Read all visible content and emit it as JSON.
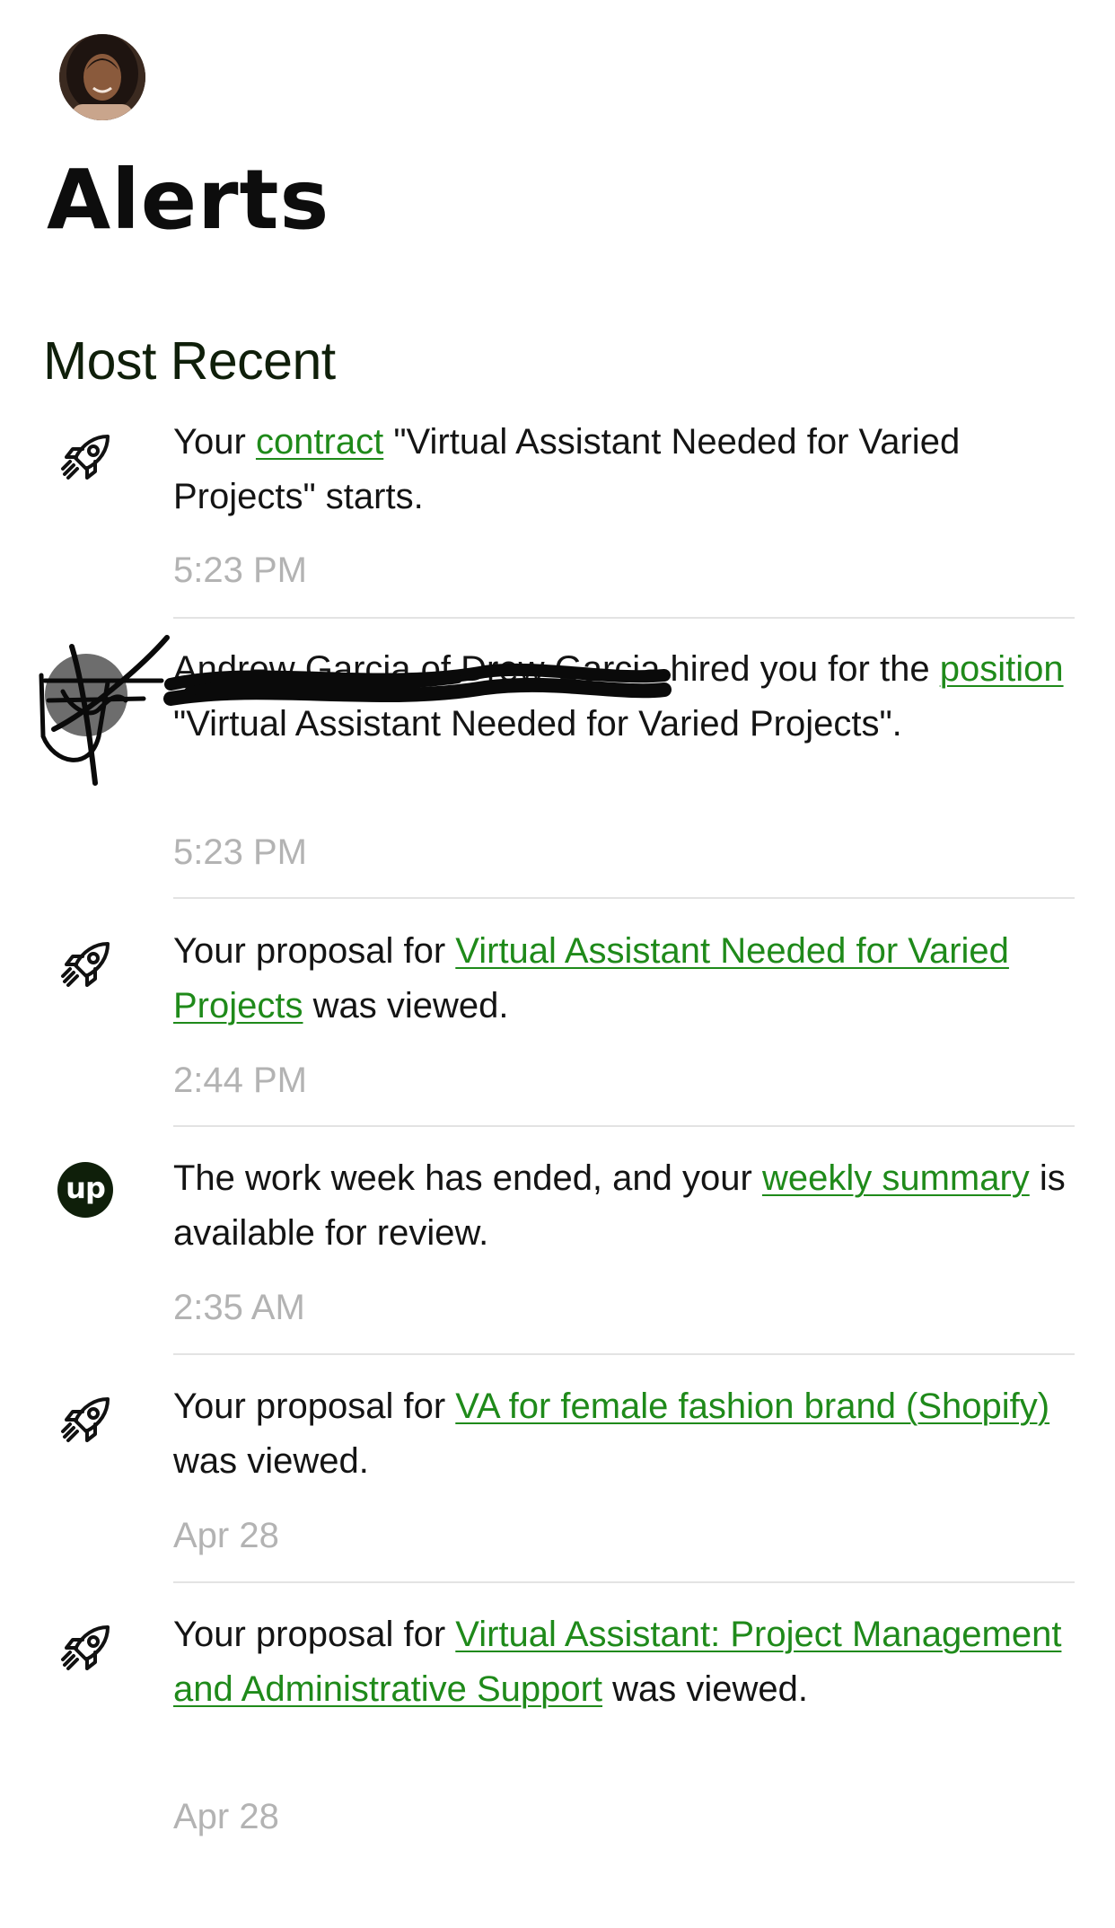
{
  "header": {
    "title": "Alerts",
    "avatar_icon": "user-avatar"
  },
  "section": {
    "title": "Most Recent"
  },
  "colors": {
    "link": "#1f8a1a",
    "timestamp": "#b3b3b3",
    "brand": "#0f1f0a"
  },
  "alerts": [
    {
      "icon": "rocket-icon",
      "pre": "Your ",
      "link": "contract",
      "post": " \"Virtual Assistant Needed for Varied Projects\" starts.",
      "time": "5:23 PM"
    },
    {
      "icon": "client-avatar",
      "pre": "Andrew Garcia of Drew Garcia hired you for the ",
      "link": "position",
      "post": " \"Virtual Assistant Needed for Varied Projects\".",
      "time": "5:23 PM",
      "redacted": true
    },
    {
      "icon": "rocket-icon",
      "pre": "Your proposal for ",
      "link": "Virtual Assistant Needed for Varied Projects",
      "post": " was viewed.",
      "time": "2:44 PM"
    },
    {
      "icon": "upwork-logo-icon",
      "logo_text": "up",
      "pre": "The work week has ended, and your ",
      "link": "weekly summary",
      "post": " is available for review.",
      "time": "2:35 AM"
    },
    {
      "icon": "rocket-icon",
      "pre": "Your proposal for ",
      "link": "VA for female fashion brand (Shopify)",
      "post": " was viewed.",
      "time": "Apr 28"
    },
    {
      "icon": "rocket-icon",
      "pre": "Your proposal for ",
      "link": "Virtual Assistant: Project Management and Administrative Support",
      "post": " was viewed.",
      "time": "Apr 28"
    }
  ]
}
